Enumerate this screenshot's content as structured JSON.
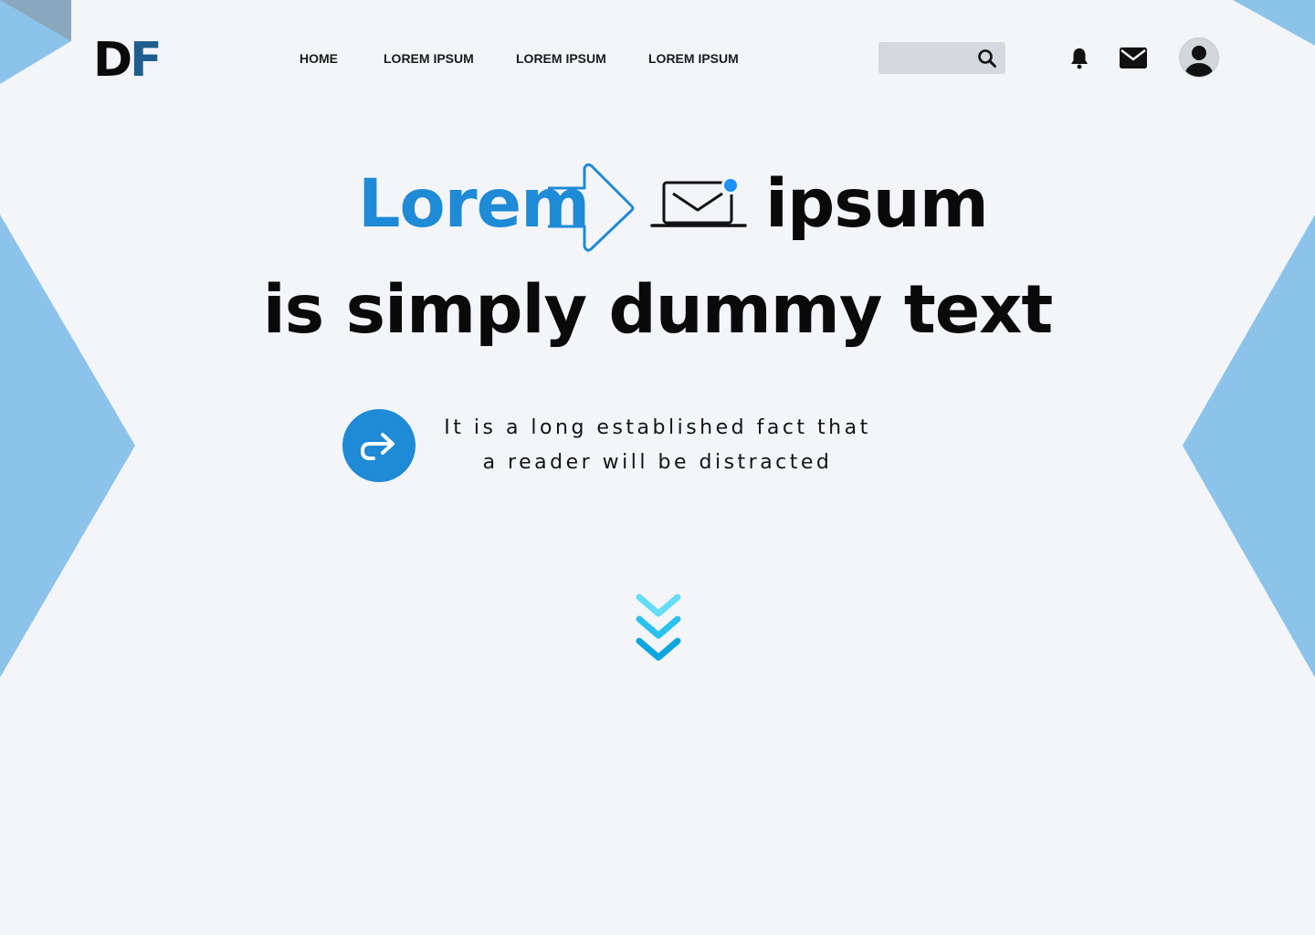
{
  "logo": {
    "part1": "D",
    "part2": "F"
  },
  "nav": {
    "items": [
      "HOME",
      "LOREM IPSUM",
      "LOREM IPSUM",
      "LOREM IPSUM"
    ]
  },
  "search": {
    "value": "",
    "placeholder": "",
    "icon": "search-icon"
  },
  "header_icons": [
    "bell-icon",
    "envelope-icon",
    "user-avatar-icon"
  ],
  "hero": {
    "word1": "Lorem",
    "word2": "ipsum",
    "line2": "is simply dummy text",
    "decorations": [
      "arrow-right-outline-icon",
      "laptop-mail-icon"
    ]
  },
  "description": {
    "line1": "It is a long established fact that",
    "line2": "a reader will be distracted"
  },
  "share_button": {
    "icon": "share-arrow-icon"
  },
  "scroll_down": {
    "icon": "triple-chevron-down-icon"
  },
  "colors": {
    "background": "#f3f5f9",
    "accent": "#1f8ad6",
    "decor_blue": "#8cc3ea",
    "logo_f": "#1e5f8f",
    "search_bg": "#d5d8de",
    "chevron_light": "#66ddf7",
    "chevron_mid": "#28c2ee",
    "chevron_dark": "#0aa6df"
  }
}
